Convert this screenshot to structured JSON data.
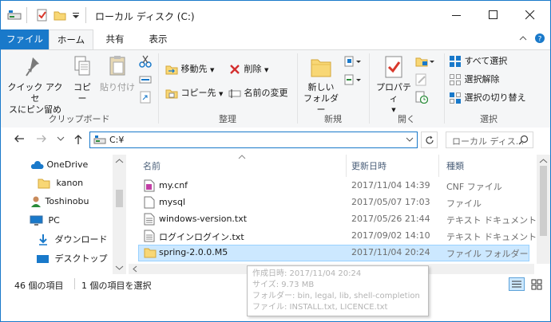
{
  "window": {
    "title": "ローカル ディスク (C:)",
    "accent": "#1979ca"
  },
  "ribbon_tabs": {
    "file": "ファイル",
    "home": "ホーム",
    "share": "共有",
    "view": "表示"
  },
  "ribbon": {
    "clipboard": {
      "pin": "クイック アクセ\nスにピン留め",
      "copy": "コピー",
      "paste": "貼り付け",
      "label": "クリップボード"
    },
    "organize": {
      "move_to": "移動先",
      "copy_to": "コピー先",
      "delete": "削除",
      "rename": "名前の変更",
      "label": "整理"
    },
    "new": {
      "new_folder": "新しい\nフォルダー",
      "label": "新規"
    },
    "open": {
      "properties": "プロパティ",
      "label": "開く"
    },
    "select": {
      "select_all": "すべて選択",
      "select_none": "選択解除",
      "invert": "選択の切り替え",
      "label": "選択"
    }
  },
  "address": {
    "path": "C:¥",
    "search_placeholder": "ローカル ディス..."
  },
  "nav_pane": {
    "items": [
      {
        "label": "OneDrive",
        "icon": "cloud-icon"
      },
      {
        "label": "kanon",
        "icon": "folder-icon"
      },
      {
        "label": "Toshinobu",
        "icon": "user-icon"
      },
      {
        "label": "PC",
        "icon": "pc-icon"
      },
      {
        "label": "ダウンロード",
        "icon": "download-icon"
      },
      {
        "label": "デスクトップ",
        "icon": "desktop-icon"
      }
    ]
  },
  "columns": {
    "name": "名前",
    "modified": "更新日時",
    "type": "種類"
  },
  "files": [
    {
      "name": "my.cnf",
      "modified": "2017/11/04 14:39",
      "type": "CNF ファイル",
      "icon": "cnf-file-icon"
    },
    {
      "name": "mysql",
      "modified": "2017/05/07 17:03",
      "type": "ファイル",
      "icon": "file-icon"
    },
    {
      "name": "windows-version.txt",
      "modified": "2017/05/26 21:44",
      "type": "テキスト ドキュメント",
      "icon": "text-file-icon"
    },
    {
      "name": "ログインログイン.txt",
      "modified": "2017/09/02 14:10",
      "type": "テキスト ドキュメント",
      "icon": "text-file-icon"
    },
    {
      "name": "spring-2.0.0.M5",
      "modified": "2017/11/04 20:24",
      "type": "ファイル フォルダー",
      "icon": "folder-icon"
    }
  ],
  "tooltip": {
    "created": "作成日時: 2017/11/04 20:24",
    "size": "サイズ: 9.73 MB",
    "folders": "フォルダー: bin, legal, lib, shell-completion",
    "files": "ファイル: INSTALL.txt, LICENCE.txt"
  },
  "status": {
    "count": "46 個の項目",
    "selected": "1 個の項目を選択"
  }
}
